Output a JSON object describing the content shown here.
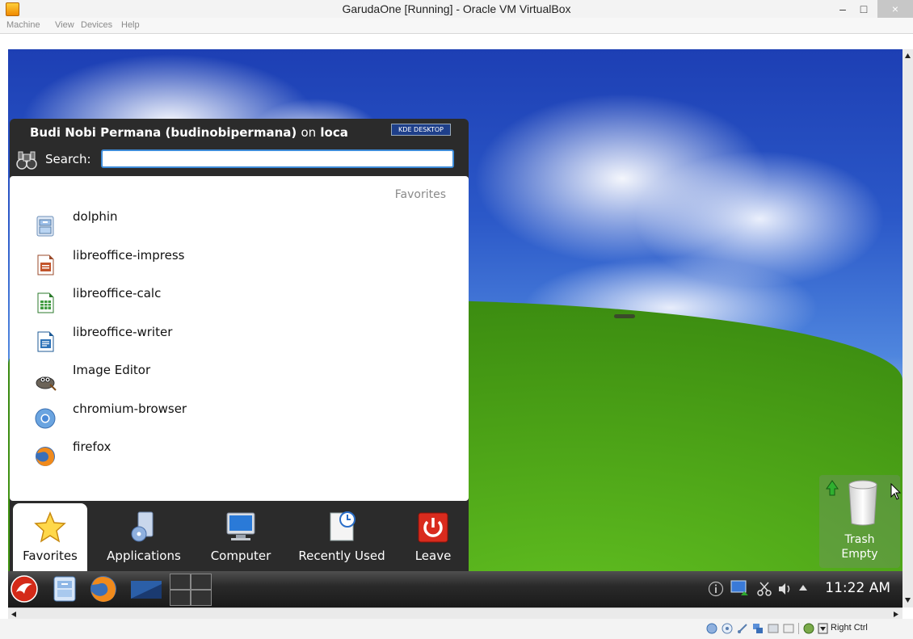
{
  "window": {
    "title": "GarudaOne [Running] - Oracle VM VirtualBox",
    "controls": [
      "–",
      "□",
      "×"
    ]
  },
  "menubar": {
    "items": [
      "Machine",
      "View",
      "Devices",
      "Help"
    ]
  },
  "kde_menu": {
    "header_user": "Budi Nobi Permana (budinobipermana)",
    "header_on": "on",
    "header_host": "loca",
    "badge": "KDE DESKTOP",
    "search_label": "Search:",
    "search_value": "",
    "favorites_heading": "Favorites",
    "favorites": [
      {
        "label": "dolphin",
        "icon": "file-manager-icon"
      },
      {
        "label": "libreoffice-impress",
        "icon": "impress-icon"
      },
      {
        "label": "libreoffice-calc",
        "icon": "calc-icon"
      },
      {
        "label": "libreoffice-writer",
        "icon": "writer-icon"
      },
      {
        "label": "Image Editor",
        "icon": "gimp-icon"
      },
      {
        "label": "chromium-browser",
        "icon": "chromium-icon"
      },
      {
        "label": "firefox",
        "icon": "firefox-icon"
      }
    ],
    "tabs": [
      {
        "label": "Favorites",
        "icon": "star-icon",
        "active": true
      },
      {
        "label": "Applications",
        "icon": "applications-icon",
        "active": false
      },
      {
        "label": "Computer",
        "icon": "computer-icon",
        "active": false
      },
      {
        "label": "Recently Used",
        "icon": "recent-icon",
        "active": false
      },
      {
        "label": "Leave",
        "icon": "power-icon",
        "active": false
      }
    ]
  },
  "desktop": {
    "trash_label": "Trash",
    "trash_status": "Empty"
  },
  "taskbar": {
    "clock": "11:22 AM"
  },
  "statusbar": {
    "host_key": "Right Ctrl"
  },
  "colors": {
    "accent": "#3d8bd8",
    "menu_bg": "#2b2b2b",
    "leave_red": "#d92b1e"
  }
}
